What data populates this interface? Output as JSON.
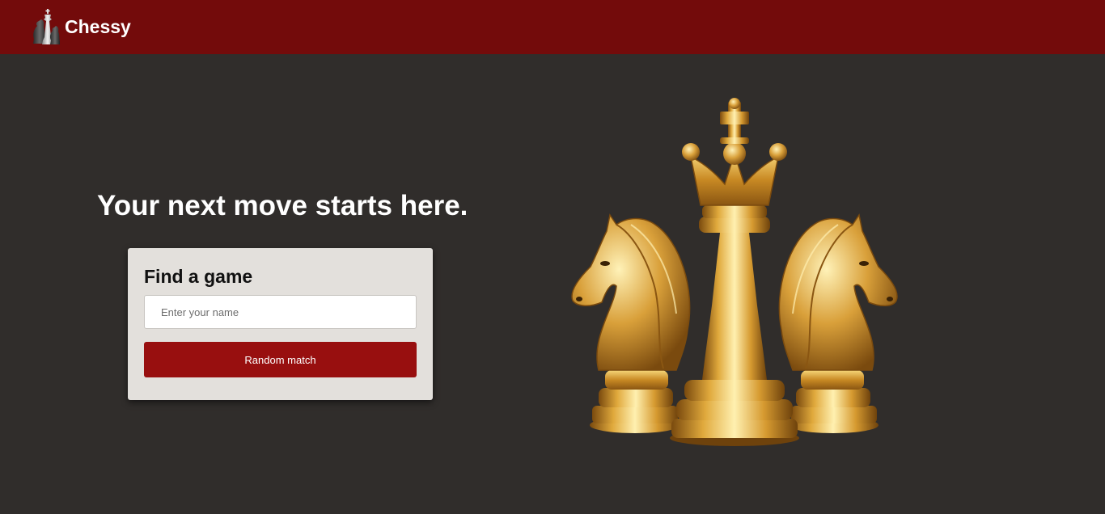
{
  "header": {
    "brand": "Chessy",
    "background": "#730b0b",
    "logo_icon": "chess-pieces-logo-icon"
  },
  "hero": {
    "headline": "Your next move starts here.",
    "image_icon": "golden-chess-pieces-illustration"
  },
  "find_game": {
    "title": "Find a game",
    "name_input": {
      "placeholder": "Enter your name",
      "value": ""
    },
    "random_match_label": "Random match",
    "button_color": "#980f0f"
  },
  "colors": {
    "page_background": "#302d2b",
    "card_background": "#e3e0dc",
    "accent_gold": "#d4a23a"
  }
}
